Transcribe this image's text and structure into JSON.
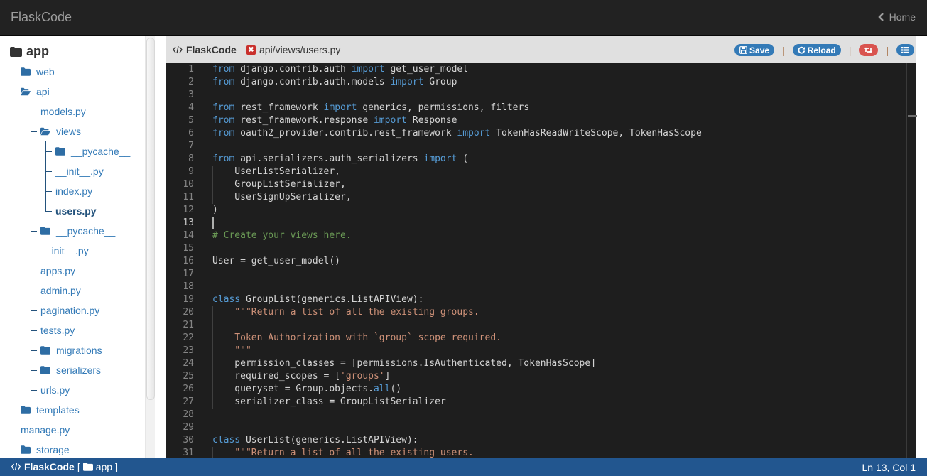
{
  "navbar": {
    "brand": "FlaskCode",
    "home_label": "Home"
  },
  "sidebar": {
    "root": "app",
    "items": [
      {
        "label": "web",
        "type": "folder"
      },
      {
        "label": "api",
        "type": "folder-open"
      },
      {
        "label": "models.py",
        "type": "file"
      },
      {
        "label": "views",
        "type": "folder-open"
      },
      {
        "label": "__pycache__",
        "type": "folder"
      },
      {
        "label": "__init__.py",
        "type": "file"
      },
      {
        "label": "index.py",
        "type": "file"
      },
      {
        "label": "users.py",
        "type": "file",
        "active": true
      },
      {
        "label": "__pycache__",
        "type": "folder"
      },
      {
        "label": "__init__.py",
        "type": "file"
      },
      {
        "label": "apps.py",
        "type": "file"
      },
      {
        "label": "admin.py",
        "type": "file"
      },
      {
        "label": "pagination.py",
        "type": "file"
      },
      {
        "label": "tests.py",
        "type": "file"
      },
      {
        "label": "migrations",
        "type": "folder"
      },
      {
        "label": "serializers",
        "type": "folder"
      },
      {
        "label": "urls.py",
        "type": "file"
      },
      {
        "label": "templates",
        "type": "folder"
      },
      {
        "label": "manage.py",
        "type": "file"
      },
      {
        "label": "storage",
        "type": "folder"
      }
    ]
  },
  "panel": {
    "title": "FlaskCode",
    "file_path": "api/views/users.py",
    "close_glyph": "✖",
    "save_label": "Save",
    "reload_label": "Reload"
  },
  "editor": {
    "current_line": 13,
    "lines": [
      [
        [
          "kw",
          "from"
        ],
        [
          "",
          "  django.contrib.auth "
        ],
        [
          "kw",
          "import"
        ],
        [
          "",
          " get_user_model"
        ]
      ],
      [
        [
          "kw",
          "from"
        ],
        [
          "",
          " django.contrib.auth.models "
        ],
        [
          "kw",
          "import"
        ],
        [
          "",
          " Group"
        ]
      ],
      [],
      [
        [
          "kw",
          "from"
        ],
        [
          "",
          " rest_framework "
        ],
        [
          "kw",
          "import"
        ],
        [
          "",
          " generics, permissions, filters"
        ]
      ],
      [
        [
          "kw",
          "from"
        ],
        [
          "",
          " rest_framework.response "
        ],
        [
          "kw",
          "import"
        ],
        [
          "",
          " Response"
        ]
      ],
      [
        [
          "kw",
          "from"
        ],
        [
          "",
          " oauth2_provider.contrib.rest_framework "
        ],
        [
          "kw",
          "import"
        ],
        [
          "",
          " TokenHasReadWriteScope, TokenHasScope"
        ]
      ],
      [],
      [
        [
          "kw",
          "from"
        ],
        [
          "",
          " api.serializers.auth_serializers "
        ],
        [
          "kw",
          "import"
        ],
        [
          "",
          " ("
        ]
      ],
      [
        [
          "",
          "    UserListSerializer,"
        ]
      ],
      [
        [
          "",
          "    GroupListSerializer,"
        ]
      ],
      [
        [
          "",
          "    UserSignUpSerializer,"
        ]
      ],
      [
        [
          "",
          ")"
        ]
      ],
      [],
      [
        [
          "cm",
          "# Create your views here."
        ]
      ],
      [],
      [
        [
          "",
          "User = get_user_model()"
        ]
      ],
      [],
      [],
      [
        [
          "kw",
          "class"
        ],
        [
          "",
          " GroupList(generics.ListAPIView):"
        ]
      ],
      [
        [
          "st",
          "    \"\"\"Return a list of all the existing groups."
        ]
      ],
      [],
      [
        [
          "st",
          "    Token Authorization with `group` scope required."
        ]
      ],
      [
        [
          "st",
          "    \"\"\""
        ]
      ],
      [
        [
          "",
          "    permission_classes = [permissions.IsAuthenticated, TokenHasScope]"
        ]
      ],
      [
        [
          "",
          "    required_scopes = ["
        ],
        [
          "st",
          "'groups'"
        ],
        [
          "",
          "]"
        ]
      ],
      [
        [
          "",
          "    queryset = Group.objects."
        ],
        [
          "kw",
          "all"
        ],
        [
          "",
          "()"
        ]
      ],
      [
        [
          "",
          "    serializer_class = GroupListSerializer"
        ]
      ],
      [],
      [],
      [
        [
          "kw",
          "class"
        ],
        [
          "",
          " UserList(generics.ListAPIView):"
        ]
      ],
      [
        [
          "st",
          "    \"\"\"Return a list of all the existing users."
        ]
      ]
    ]
  },
  "statusbar": {
    "app_name": "FlaskCode",
    "open_bracket": "[",
    "folder": "app",
    "close_bracket": "]",
    "cursor_position": "Ln 13, Col 1"
  }
}
